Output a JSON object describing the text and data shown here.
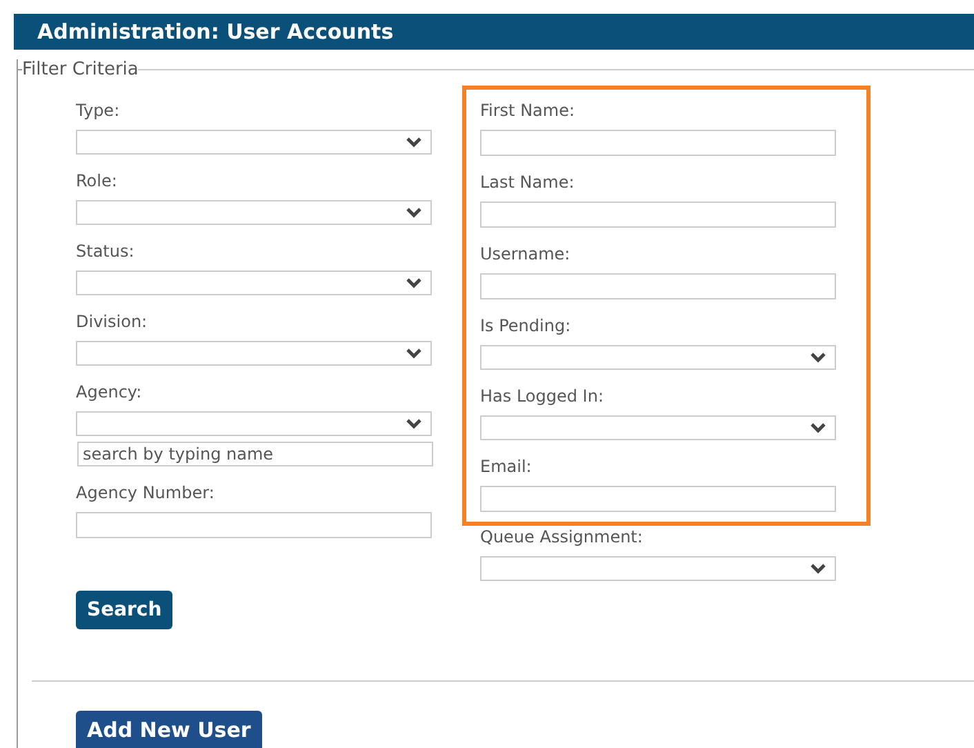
{
  "header": {
    "title": "Administration: User Accounts"
  },
  "filter": {
    "legend": "Filter Criteria",
    "left_fields": [
      {
        "label": "Type:",
        "kind": "select"
      },
      {
        "label": "Role:",
        "kind": "select"
      },
      {
        "label": "Status:",
        "kind": "select"
      },
      {
        "label": "Division:",
        "kind": "select"
      },
      {
        "label": "Agency:",
        "kind": "select",
        "search_placeholder": "search by typing name"
      },
      {
        "label": "Agency Number:",
        "kind": "text"
      }
    ],
    "highlighted_fields": [
      {
        "label": "First Name:",
        "kind": "text"
      },
      {
        "label": "Last Name:",
        "kind": "text"
      },
      {
        "label": "Username:",
        "kind": "text"
      },
      {
        "label": "Is Pending:",
        "kind": "select"
      },
      {
        "label": "Has Logged In:",
        "kind": "select"
      },
      {
        "label": "Email:",
        "kind": "text"
      }
    ],
    "right_fields": [
      {
        "label": "Queue Assignment:",
        "kind": "select"
      }
    ],
    "search_button": "Search"
  },
  "add_button": "Add New User"
}
